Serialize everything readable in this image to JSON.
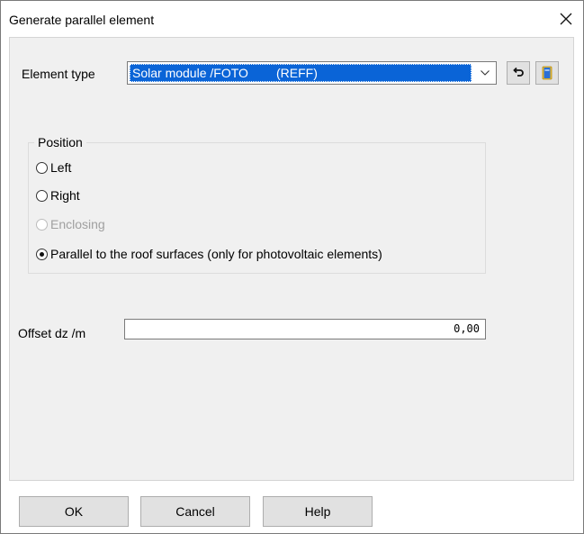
{
  "dialog": {
    "title": "Generate parallel element",
    "close_icon": "close-icon"
  },
  "element_type": {
    "label": "Element type",
    "selected_value": "Solar module /FOTO        (REFF)",
    "dropdown_icon": "chevron-down-icon",
    "undo_icon": "undo-icon",
    "library_icon": "book-icon"
  },
  "position": {
    "legend": "Position",
    "options": [
      {
        "label": "Left",
        "checked": false,
        "enabled": true
      },
      {
        "label": "Right",
        "checked": false,
        "enabled": true
      },
      {
        "label": "Enclosing",
        "checked": false,
        "enabled": false
      },
      {
        "label": "Parallel to the roof surfaces (only for photovoltaic elements)",
        "checked": true,
        "enabled": true
      }
    ]
  },
  "offset": {
    "label": "Offset dz /m",
    "value": "0,00"
  },
  "buttons": {
    "ok": "OK",
    "cancel": "Cancel",
    "help": "Help"
  },
  "colors": {
    "selection": "#0a64d7",
    "client_background": "#f0f0f0",
    "button_face": "#e1e1e1"
  }
}
